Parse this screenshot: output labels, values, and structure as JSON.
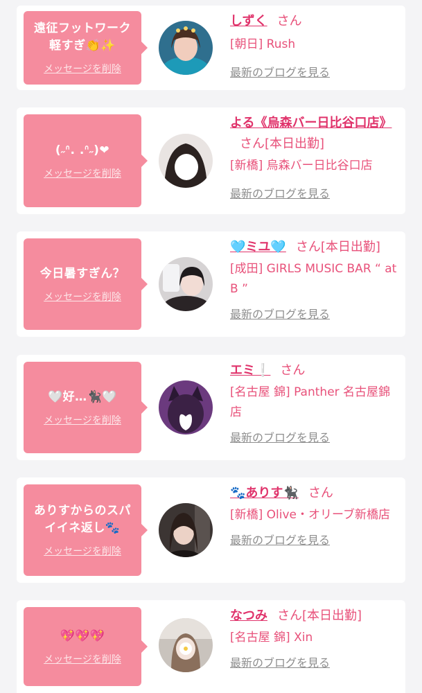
{
  "delete_label": "メッセージを削除",
  "san_label": "さん",
  "blog_label": "最新のブログを見る",
  "colors": {
    "bubble": "#f58c9e",
    "name": "#e0336b",
    "text": "#e8517a",
    "link": "#8e8e8e"
  },
  "cards": [
    {
      "message": "遠征フットワーク\n軽すぎ👏✨",
      "name": "しずく",
      "tag": "",
      "shop": "[朝日] Rush"
    },
    {
      "message": "(˶ᐢ. .ᐢ˶)❤",
      "name": "よる《烏森バー日比谷口店》",
      "tag": "[本日出勤]",
      "shop": "[新橋] 烏森バー日比谷口店"
    },
    {
      "message": "今日暑すぎん？",
      "name": "🩵ミユ🩵",
      "tag": "[本日出勤]",
      "shop": "[成田] GIRLS MUSIC BAR “ at B ”"
    },
    {
      "message": "🤍好…🐈‍⬛🤍",
      "name": "エミ❕",
      "tag": "",
      "shop": "[名古屋 錦] Panther 名古屋錦店"
    },
    {
      "message": "ありすからのスパ\nイイネ返し🐾",
      "name": "🐾ありす🐈‍⬛",
      "tag": "",
      "shop": "[新橋] Olive・オリーブ新橋店"
    },
    {
      "message": "💖💖💖",
      "name": "なつみ",
      "tag": "[本日出勤]",
      "shop": "[名古屋 錦] Xin"
    }
  ]
}
